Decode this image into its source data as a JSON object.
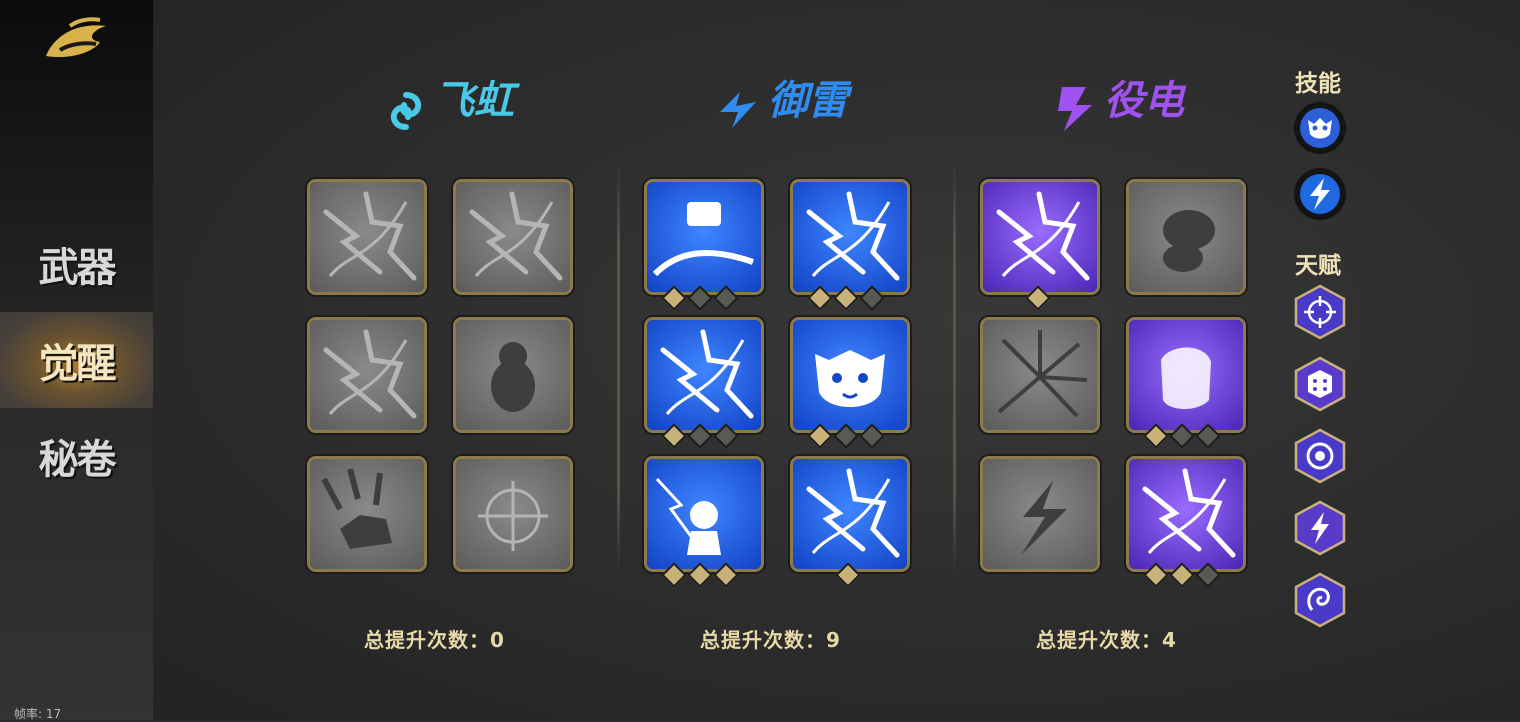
{
  "sidebar": {
    "items": [
      {
        "label": "武器"
      },
      {
        "label": "觉醒"
      },
      {
        "label": "秘卷"
      }
    ],
    "active_index": 1,
    "fps_text": "帧率: 17"
  },
  "columns": [
    {
      "title": "飞虹",
      "color": "#49c8e8",
      "icon": "swirl-icon",
      "total_label": "总提升次数：0",
      "cards": [
        {
          "icon": "wind-slash-icon",
          "state": "locked",
          "level": 0,
          "max": 0
        },
        {
          "icon": "vortex-icon",
          "state": "locked",
          "level": 0,
          "max": 0
        },
        {
          "icon": "claw-slash-icon",
          "state": "locked",
          "level": 0,
          "max": 0
        },
        {
          "icon": "bear-figure-icon",
          "state": "locked",
          "level": 0,
          "max": 0
        },
        {
          "icon": "falling-warrior-icon",
          "state": "locked",
          "level": 0,
          "max": 0
        },
        {
          "icon": "crosshair-icon",
          "state": "locked",
          "level": 0,
          "max": 0
        }
      ]
    },
    {
      "title": "御雷",
      "color": "#2f8cf0",
      "icon": "thunder-arrow-icon",
      "total_label": "总提升次数：9",
      "cards": [
        {
          "icon": "thunder-hammer-icon",
          "state": "unlocked",
          "level": 1,
          "max": 3
        },
        {
          "icon": "lightning-storm-icon",
          "state": "unlocked",
          "level": 2,
          "max": 3
        },
        {
          "icon": "lightning-wave-icon",
          "state": "unlocked",
          "level": 1,
          "max": 3
        },
        {
          "icon": "tiger-face-icon",
          "state": "unlocked",
          "level": 1,
          "max": 3
        },
        {
          "icon": "thunder-god-icon",
          "state": "unlocked",
          "level": 3,
          "max": 3
        },
        {
          "icon": "lightning-burst-icon",
          "state": "unlocked",
          "level": 1,
          "max": 1
        }
      ]
    },
    {
      "title": "役电",
      "color": "#a052f0",
      "icon": "lightning-bolt-icon",
      "total_label": "总提升次数：4",
      "cards": [
        {
          "icon": "purple-lightning-icon",
          "state": "unlocked",
          "level": 1,
          "max": 1
        },
        {
          "icon": "cloud-spirit-icon",
          "state": "locked",
          "level": 0,
          "max": 0
        },
        {
          "icon": "shatter-icon",
          "state": "locked",
          "level": 0,
          "max": 0
        },
        {
          "icon": "electric-fist-icon",
          "state": "unlocked",
          "level": 1,
          "max": 3
        },
        {
          "icon": "zigzag-bolt-icon",
          "state": "locked",
          "level": 0,
          "max": 0
        },
        {
          "icon": "chain-lightning-icon",
          "state": "unlocked",
          "level": 2,
          "max": 3
        }
      ]
    }
  ],
  "right_panel": {
    "skills_label": "技能",
    "talents_label": "天赋",
    "skills": [
      {
        "icon": "tiger-skill-icon"
      },
      {
        "icon": "lightning-skill-icon"
      }
    ],
    "talents": [
      {
        "icon": "target-talent-icon"
      },
      {
        "icon": "dice-talent-icon"
      },
      {
        "icon": "eye-talent-icon"
      },
      {
        "icon": "bolt-talent-icon"
      },
      {
        "icon": "spiral-talent-icon"
      }
    ]
  },
  "colors": {
    "card_border": "#8c7a4a",
    "gem_on": "#c8b27a",
    "gem_off": "#5a5a55",
    "blue_card": "#1c5ee6",
    "purple_card": "#6a3ee0",
    "locked_card": "#707070"
  }
}
